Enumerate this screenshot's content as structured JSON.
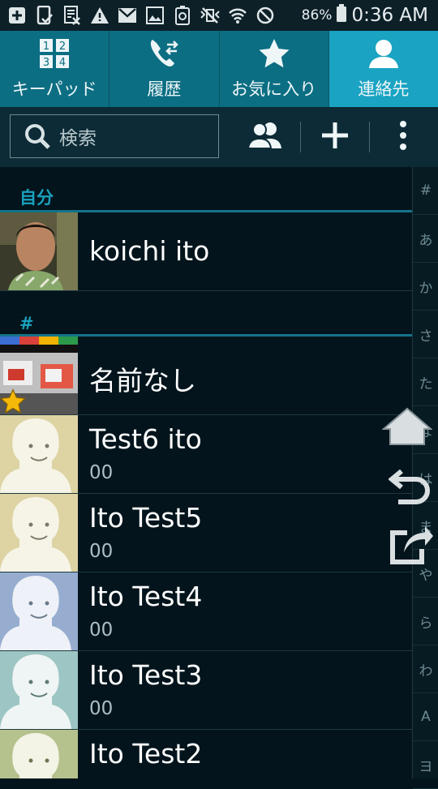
{
  "status_bar": {
    "battery_percent": "86%",
    "time": "0:36 AM",
    "icons": [
      "plus-box-icon",
      "phone-check-icon",
      "spreadsheet-x-icon",
      "warning-icon",
      "gmail-icon",
      "image-icon",
      "recycle-battery-icon",
      "mute-vibrate-icon",
      "wifi-icon",
      "no-signal-icon",
      "battery-icon"
    ]
  },
  "tabs": [
    {
      "label": "キーパッド",
      "icon": "keypad-icon"
    },
    {
      "label": "履歴",
      "icon": "call-log-icon"
    },
    {
      "label": "お気に入り",
      "icon": "star-icon"
    },
    {
      "label": "連絡先",
      "icon": "person-icon",
      "active": true
    }
  ],
  "search": {
    "placeholder": "検索"
  },
  "actions": [
    {
      "name": "groups",
      "icon": "groups-icon"
    },
    {
      "name": "add",
      "icon": "plus-icon"
    },
    {
      "name": "more",
      "icon": "overflow-menu-icon"
    }
  ],
  "sections": {
    "me": {
      "label": "自分"
    },
    "hash": {
      "label": "#"
    }
  },
  "me_contact": {
    "name": "koichi ito"
  },
  "contacts": [
    {
      "name": "名前なし",
      "number": "",
      "thumb": "keyboard-photo",
      "bg": "#c8c8c8",
      "favorite": true
    },
    {
      "name": "Test6 ito",
      "number": "00",
      "thumb": "avatar",
      "bg": "#ddd3a3"
    },
    {
      "name": "Ito Test5",
      "number": "00",
      "thumb": "avatar",
      "bg": "#ddd3a3"
    },
    {
      "name": "Ito Test4",
      "number": "00",
      "thumb": "avatar",
      "bg": "#96add0"
    },
    {
      "name": "Ito Test3",
      "number": "00",
      "thumb": "avatar",
      "bg": "#9dc5c3"
    },
    {
      "name": "Ito Test2",
      "number": "",
      "thumb": "avatar",
      "bg": "#b6c28e"
    }
  ],
  "index_letters": [
    "#",
    "あ",
    "か",
    "さ",
    "た",
    "な",
    "は",
    "ま",
    "や",
    "ら",
    "わ",
    "A",
    "ヨ"
  ],
  "floating_buttons": [
    "home-icon",
    "back-icon",
    "share-icon"
  ],
  "colors": {
    "accent": "#1aa3c2",
    "tab_bg": "#0c6e83",
    "list_bg": "#03141c"
  }
}
